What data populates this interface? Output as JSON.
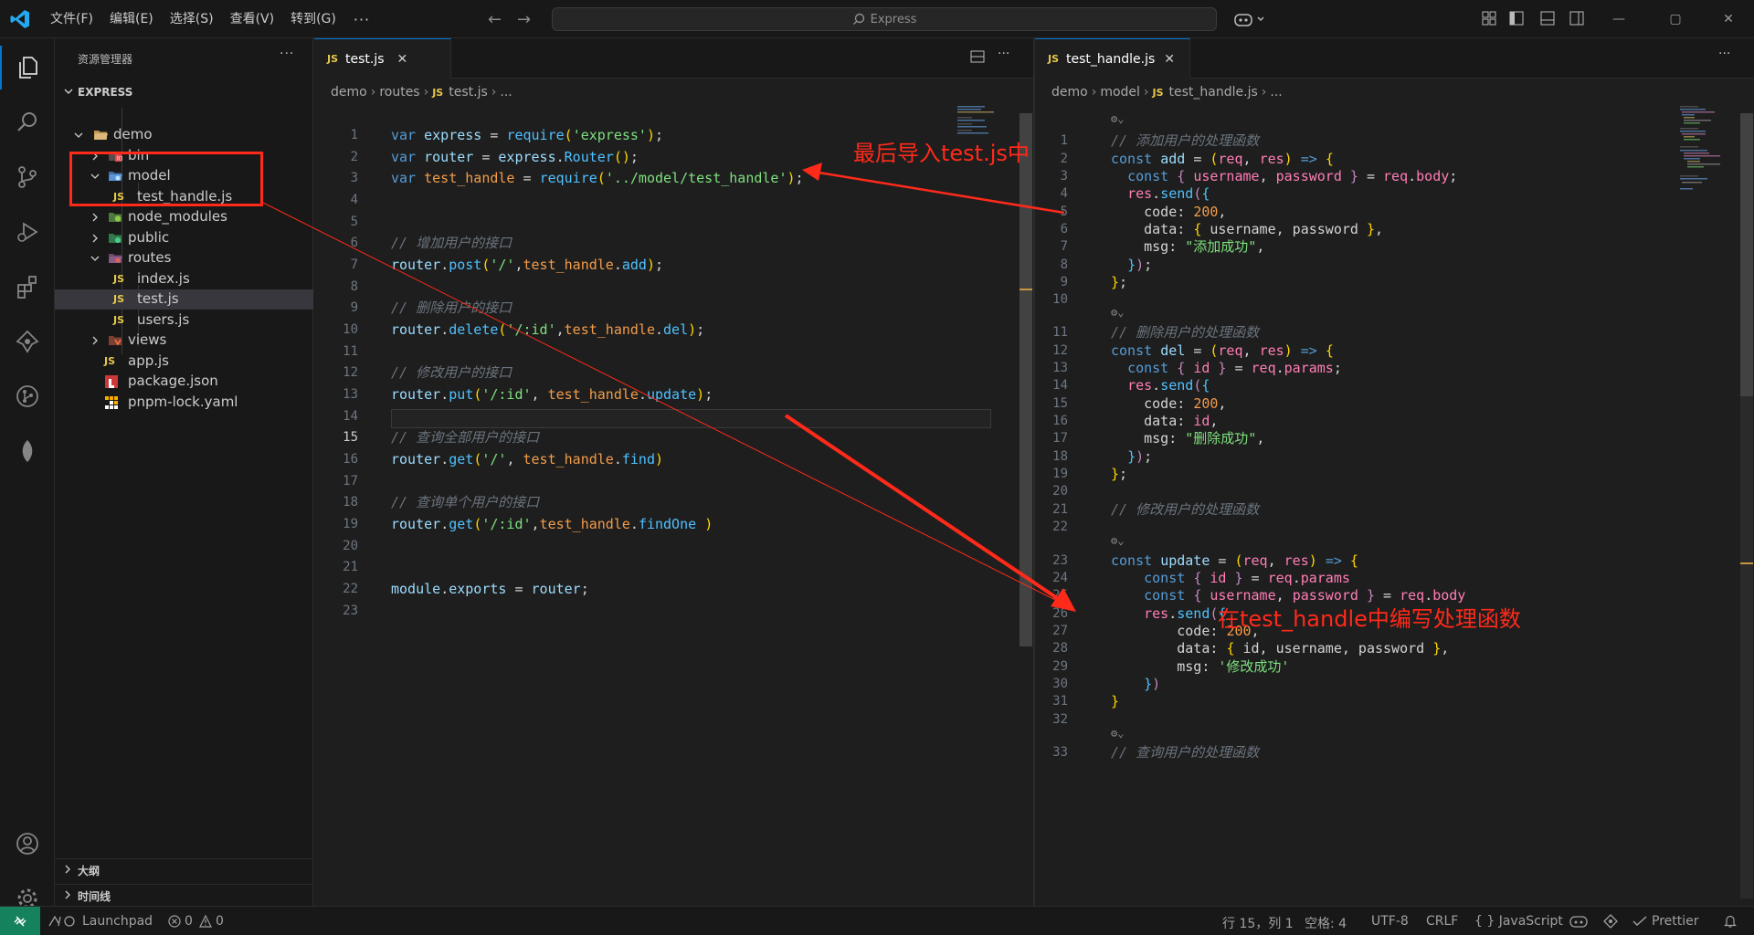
{
  "menu": [
    "文件(F)",
    "编辑(E)",
    "选择(S)",
    "查看(V)",
    "转到(G)",
    "···"
  ],
  "command_center": "Express",
  "sidebar": {
    "title": "资源管理器",
    "more": "···",
    "root": "EXPRESS",
    "tree": [
      {
        "label": "demo",
        "kind": "folder-open"
      },
      {
        "label": "bin",
        "kind": "folder"
      },
      {
        "label": "model",
        "kind": "folder-open"
      },
      {
        "label": "test_handle.js",
        "kind": "js"
      },
      {
        "label": "node_modules",
        "kind": "folder"
      },
      {
        "label": "public",
        "kind": "folder"
      },
      {
        "label": "routes",
        "kind": "folder-open"
      },
      {
        "label": "index.js",
        "kind": "js"
      },
      {
        "label": "test.js",
        "kind": "js"
      },
      {
        "label": "users.js",
        "kind": "js"
      },
      {
        "label": "views",
        "kind": "folder"
      },
      {
        "label": "app.js",
        "kind": "js"
      },
      {
        "label": "package.json",
        "kind": "npm"
      },
      {
        "label": "pnpm-lock.yaml",
        "kind": "pnpm"
      }
    ],
    "sections": [
      "大纲",
      "时间线"
    ]
  },
  "js_badge": "JS",
  "left_editor": {
    "tab_label": "test.js",
    "breadcrumb": [
      "demo",
      "routes",
      "test.js",
      "..."
    ],
    "current_line": "15"
  },
  "right_editor": {
    "tab_label": "test_handle.js",
    "breadcrumb": [
      "demo",
      "model",
      "test_handle.js",
      "..."
    ]
  },
  "annotations": {
    "import_note": "最后导入test.js中",
    "handler_note": "在test_handle中编写处理函数"
  },
  "statusbar": {
    "launchpad": "Launchpad",
    "problems": "0",
    "warnings": "0",
    "position": "行 15，列 1",
    "spaces": "空格: 4",
    "encoding": "UTF-8",
    "eol": "CRLF",
    "language": "{ } JavaScript",
    "prettier": "Prettier"
  }
}
